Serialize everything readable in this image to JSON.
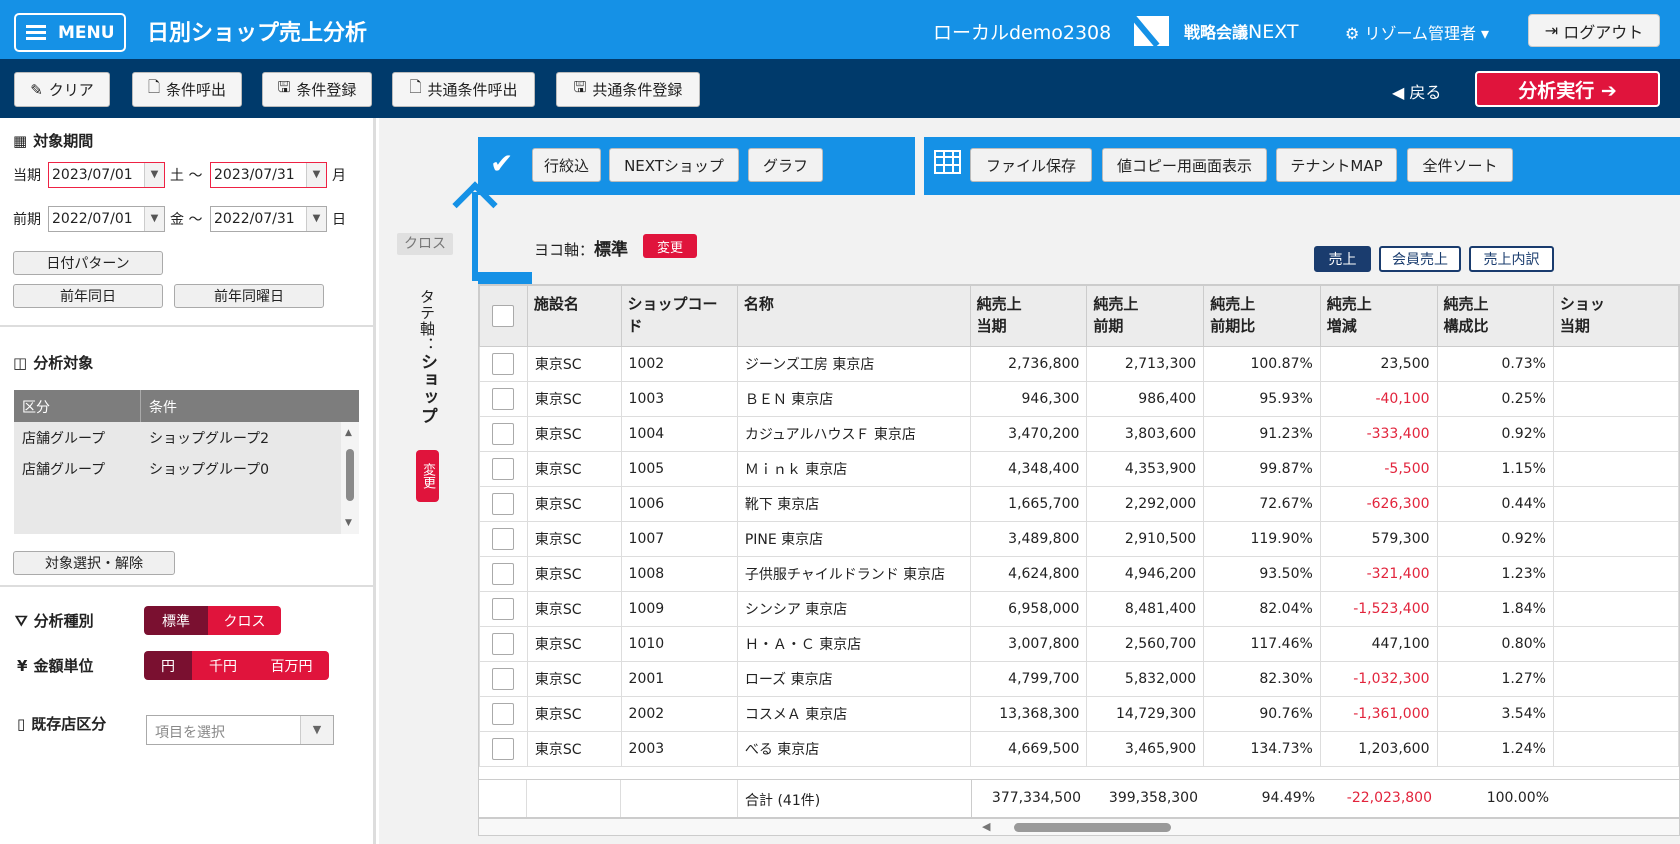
{
  "header": {
    "menu_label": "MENU",
    "title": "日別ショップ売上分析",
    "tenant": "ローカルdemo2308",
    "brand_prefix": "戦略会議",
    "brand_suffix": "NEXT",
    "user": "リゾーム管理者 ▾",
    "logout": "ログアウト"
  },
  "toolbar": {
    "clear": "クリア",
    "load": "条件呼出",
    "save": "条件登録",
    "shared_load": "共通条件呼出",
    "shared_save": "共通条件登録",
    "back": "戻る",
    "run": "分析実行 ➔"
  },
  "period": {
    "title": "対象期間",
    "current_label": "当期",
    "current_from": "2023/07/01",
    "current_from_day": "土 〜",
    "current_to": "2023/07/31",
    "current_to_day": "月",
    "prev_label": "前期",
    "prev_from": "2022/07/01",
    "prev_from_day": "金 〜",
    "prev_to": "2022/07/31",
    "prev_to_day": "日",
    "date_pattern": "日付パターン",
    "same_day": "前年同日",
    "same_weekday": "前年同曜日"
  },
  "target": {
    "title": "分析対象",
    "col_type": "区分",
    "col_cond": "条件",
    "rows": [
      {
        "type": "店舗グループ",
        "cond": "ショップグループ2"
      },
      {
        "type": "店舗グループ",
        "cond": "ショップグループ0"
      }
    ],
    "select_button": "対象選択・解除"
  },
  "analysis_type": {
    "label": "分析種別",
    "opt1": "標準",
    "opt2": "クロス"
  },
  "unit": {
    "label": "金額単位",
    "opt1": "円",
    "opt2": "千円",
    "opt3": "百万円"
  },
  "existing": {
    "label": "既存店区分",
    "placeholder": "項目を選択"
  },
  "actions": {
    "filter": "行絞込",
    "next_shop": "NEXTショップ",
    "graph": "グラフ",
    "file_save": "ファイル保存",
    "copy_view": "値コピー用画面表示",
    "tenant_map": "テナントMAP",
    "sort_all": "全件ソート"
  },
  "axes": {
    "cross_tag": "クロス",
    "vertical_prefix": "タテ軸：",
    "vertical_value": "ショップ",
    "vertical_change": "変更",
    "horizontal_prefix": "ヨコ軸：",
    "horizontal_value": "標準",
    "horizontal_change": "変更"
  },
  "view_toggle": {
    "sales": "売上",
    "member_sales": "会員売上",
    "breakdown": "売上内訳"
  },
  "table": {
    "headers": {
      "facility": "施設名",
      "code": "ショップコード",
      "name": "名称",
      "c1a": "純売上",
      "c1b": "当期",
      "c2a": "純売上",
      "c2b": "前期",
      "c3a": "純売上",
      "c3b": "前期比",
      "c4a": "純売上",
      "c4b": "増減",
      "c5a": "純売上",
      "c5b": "構成比",
      "c6a": "ショッ",
      "c6b": "当期"
    },
    "rows": [
      {
        "facility": "東京SC",
        "code": "1002",
        "name": "ジーンズ工房 東京店",
        "current": "2,736,800",
        "previous": "2,713,300",
        "ratio": "100.87%",
        "diff": "23,500",
        "share": "0.73%",
        "neg": false
      },
      {
        "facility": "東京SC",
        "code": "1003",
        "name": "ＢＥＮ 東京店",
        "current": "946,300",
        "previous": "986,400",
        "ratio": "95.93%",
        "diff": "-40,100",
        "share": "0.25%",
        "neg": true
      },
      {
        "facility": "東京SC",
        "code": "1004",
        "name": "カジュアルハウスＦ 東京店",
        "current": "3,470,200",
        "previous": "3,803,600",
        "ratio": "91.23%",
        "diff": "-333,400",
        "share": "0.92%",
        "neg": true
      },
      {
        "facility": "東京SC",
        "code": "1005",
        "name": "Ｍｉｎｋ 東京店",
        "current": "4,348,400",
        "previous": "4,353,900",
        "ratio": "99.87%",
        "diff": "-5,500",
        "share": "1.15%",
        "neg": true
      },
      {
        "facility": "東京SC",
        "code": "1006",
        "name": "靴下 東京店",
        "current": "1,665,700",
        "previous": "2,292,000",
        "ratio": "72.67%",
        "diff": "-626,300",
        "share": "0.44%",
        "neg": true
      },
      {
        "facility": "東京SC",
        "code": "1007",
        "name": "PINE 東京店",
        "current": "3,489,800",
        "previous": "2,910,500",
        "ratio": "119.90%",
        "diff": "579,300",
        "share": "0.92%",
        "neg": false
      },
      {
        "facility": "東京SC",
        "code": "1008",
        "name": "子供服チャイルドランド 東京店",
        "current": "4,624,800",
        "previous": "4,946,200",
        "ratio": "93.50%",
        "diff": "-321,400",
        "share": "1.23%",
        "neg": true
      },
      {
        "facility": "東京SC",
        "code": "1009",
        "name": "シンシア 東京店",
        "current": "6,958,000",
        "previous": "8,481,400",
        "ratio": "82.04%",
        "diff": "-1,523,400",
        "share": "1.84%",
        "neg": true
      },
      {
        "facility": "東京SC",
        "code": "1010",
        "name": "Ｈ・Ａ・Ｃ 東京店",
        "current": "3,007,800",
        "previous": "2,560,700",
        "ratio": "117.46%",
        "diff": "447,100",
        "share": "0.80%",
        "neg": false
      },
      {
        "facility": "東京SC",
        "code": "2001",
        "name": "ローズ 東京店",
        "current": "4,799,700",
        "previous": "5,832,000",
        "ratio": "82.30%",
        "diff": "-1,032,300",
        "share": "1.27%",
        "neg": true
      },
      {
        "facility": "東京SC",
        "code": "2002",
        "name": "コスメＡ 東京店",
        "current": "13,368,300",
        "previous": "14,729,300",
        "ratio": "90.76%",
        "diff": "-1,361,000",
        "share": "3.54%",
        "neg": true
      },
      {
        "facility": "東京SC",
        "code": "2003",
        "name": "べる 東京店",
        "current": "4,669,500",
        "previous": "3,465,900",
        "ratio": "134.73%",
        "diff": "1,203,600",
        "share": "1.24%",
        "neg": false
      }
    ],
    "totals": {
      "label": "合計 (41件)",
      "current": "377,334,500",
      "previous": "399,358,300",
      "ratio": "94.49%",
      "diff": "-22,023,800",
      "share": "100.00%"
    }
  }
}
